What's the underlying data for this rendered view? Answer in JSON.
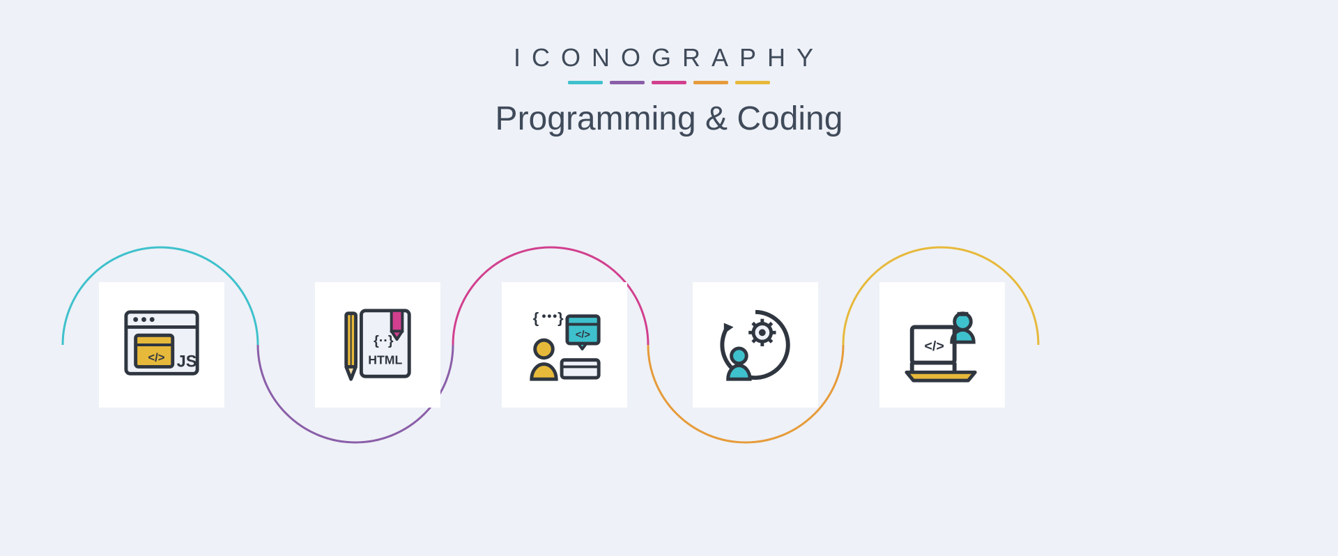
{
  "brand": "ICONOGRAPHY",
  "title": "Programming & Coding",
  "palette": {
    "teal": "#3ec1cc",
    "purple": "#8a5ea8",
    "magenta": "#d13f8e",
    "orange": "#e69b3a",
    "yellow": "#e7b93b",
    "dark": "#2f3640",
    "slate": "#3f4a5a",
    "bg": "#eef1f7"
  },
  "icons": [
    {
      "name": "js-window-icon",
      "label": "JS"
    },
    {
      "name": "html-book-pencil-icon",
      "label": "HTML"
    },
    {
      "name": "developer-code-icon",
      "label": ""
    },
    {
      "name": "user-gear-icon",
      "label": ""
    },
    {
      "name": "laptop-coder-icon",
      "label": ""
    }
  ]
}
